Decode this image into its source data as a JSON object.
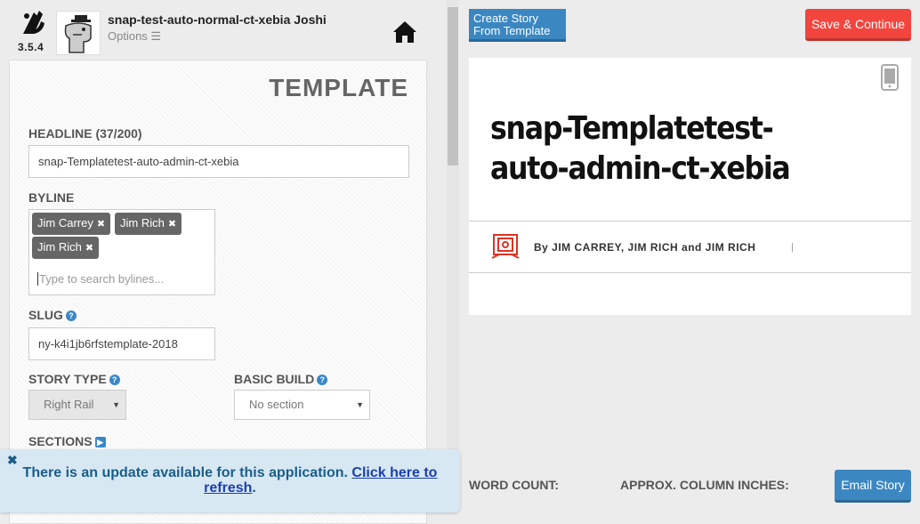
{
  "app": {
    "version": "3.5.4",
    "username": "snap-test-auto-normal-ct-xebia Joshi",
    "options_label": "Options ☰"
  },
  "template_panel": {
    "title": "TEMPLATE",
    "headline_label": "HEADLINE (37/200)",
    "headline_value": "snap-Templatetest-auto-admin-ct-xebia",
    "byline_label": "BYLINE",
    "bylines": [
      "Jim Carrey",
      "Jim Rich",
      "Jim Rich"
    ],
    "byline_placeholder": "Type to search bylines...",
    "slug_label": "SLUG",
    "slug_value": "ny-k4i1jb6rfstemplate-2018",
    "story_type_label": "STORY TYPE",
    "story_type_value": "Right Rail",
    "basic_build_label": "BASIC BUILD",
    "basic_build_value": "No section",
    "sections_label": "SECTIONS"
  },
  "update_banner": {
    "text": "There is an update available for this application. ",
    "link": "Click here to refresh",
    "suffix": "."
  },
  "toolbar": {
    "create_story_label": "Create Story From Template",
    "save_continue_label": "Save & Continue"
  },
  "preview": {
    "headline": "snap-Templatetest-auto-admin-ct-xebia",
    "byline": "By JIM CARREY, JIM RICH and JIM RICH",
    "separator": "|"
  },
  "footer": {
    "word_count_label": "WORD COUNT:",
    "column_inches_label": "APPROX. COLUMN INCHES:",
    "email_story_label": "Email Story"
  },
  "colors": {
    "accent_blue": "#3b87c2",
    "save_red": "#f2453d",
    "banner_bg": "#d7e8f3"
  }
}
